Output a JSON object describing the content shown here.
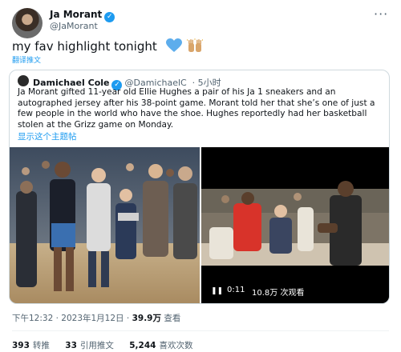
{
  "tweet": {
    "display_name": "Ja Morant",
    "handle": "@JaMorant",
    "text": "my fav highlight tonight",
    "emoji_icons": [
      "blue-heart-icon",
      "raising-hands-icon"
    ],
    "translate_label": "翻译推文"
  },
  "quote": {
    "display_name": "Damichael Cole",
    "handle": "@DamichaelC",
    "time": "· 5小时",
    "text": "Ja Morant gifted 11-year old Ellie Hughes a pair of his Ja 1 sneakers and an autographed jersey after his 38-point game. Morant told her that she’s one of just a few people in the world who have the shoe. Hughes reportedly had her basketball stolen at the Grizz game on Monday.",
    "show_thread": "显示这个主题帖",
    "video": {
      "time": "0:11",
      "views": "10.8万 次观看"
    }
  },
  "meta": {
    "timestamp": "下午12:32 · 2023年1月12日",
    "view_count": "39.9万",
    "view_label": "查看"
  },
  "stats": {
    "retweets": "393",
    "retweets_label": "转推",
    "quotes": "33",
    "quotes_label": "引用推文",
    "likes": "5,244",
    "likes_label": "喜欢次数"
  },
  "colors": {
    "accent": "#1d9bf0",
    "text": "#0f1419",
    "secondary": "#536471",
    "border": "#cfd9de"
  }
}
